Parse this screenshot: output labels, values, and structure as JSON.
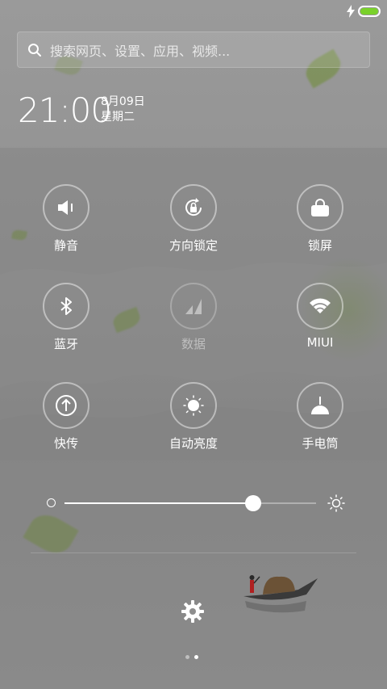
{
  "status_bar": {
    "charging_icon": "lightning-bolt",
    "battery_icon": "battery",
    "battery_level": 1.0,
    "battery_color": "#7ad12b"
  },
  "search": {
    "icon": "search-icon",
    "placeholder": "搜索网页、设置、应用、视频..."
  },
  "clock": {
    "time": "21:00",
    "date": "8月09日",
    "weekday": "星期二"
  },
  "toggles": [
    {
      "id": "mute",
      "label": "静音",
      "icon": "speaker-icon",
      "enabled": true
    },
    {
      "id": "rotation-lock",
      "label": "方向锁定",
      "icon": "rotation-lock-icon",
      "enabled": true
    },
    {
      "id": "lock-screen",
      "label": "锁屏",
      "icon": "lock-icon",
      "enabled": true
    },
    {
      "id": "bluetooth",
      "label": "蓝牙",
      "icon": "bluetooth-icon",
      "enabled": true
    },
    {
      "id": "data",
      "label": "数据",
      "icon": "mobile-data-icon",
      "enabled": false
    },
    {
      "id": "wifi",
      "label": "MIUI",
      "icon": "wifi-icon",
      "enabled": true
    },
    {
      "id": "quick-transfer",
      "label": "快传",
      "icon": "upload-icon",
      "enabled": true
    },
    {
      "id": "auto-brightness",
      "label": "自动亮度",
      "icon": "sun-icon",
      "enabled": true
    },
    {
      "id": "flashlight",
      "label": "手电筒",
      "icon": "flashlight-icon",
      "enabled": true
    }
  ],
  "brightness": {
    "level": 0.75,
    "min_icon": "dim-circle-icon",
    "max_icon": "sun-icon"
  },
  "bottom": {
    "settings_icon": "gear-icon",
    "pages": 2,
    "current_page": 2
  }
}
